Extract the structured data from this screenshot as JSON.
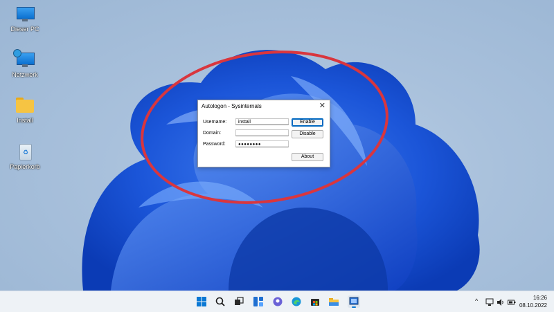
{
  "desktop": {
    "icons": [
      {
        "label": "Dieser PC",
        "icon": "this-pc-icon"
      },
      {
        "label": "Netzwerk",
        "icon": "network-icon"
      },
      {
        "label": "Install",
        "icon": "folder-icon"
      },
      {
        "label": "Papierkorb",
        "icon": "recycle-bin-icon"
      }
    ]
  },
  "dialog": {
    "title": "Autologon - Sysinternals",
    "close_glyph": "✕",
    "username_label": "Username:",
    "username_value": "install",
    "domain_label": "Domain:",
    "domain_value": "",
    "password_label": "Password:",
    "password_value": "●●●●●●●●",
    "enable_label": "Enable",
    "disable_label": "Disable",
    "about_label": "About"
  },
  "annotation": {
    "shape": "ellipse",
    "color": "#d9363e"
  },
  "taskbar": {
    "apps": [
      "start-icon",
      "search-icon",
      "task-view-icon",
      "widgets-icon",
      "chat-icon",
      "edge-icon",
      "store-icon",
      "file-explorer-icon",
      "autologon-app-icon"
    ],
    "tray_chevron": "^",
    "clock_time": "16:26",
    "clock_date": "08.10.2022"
  }
}
